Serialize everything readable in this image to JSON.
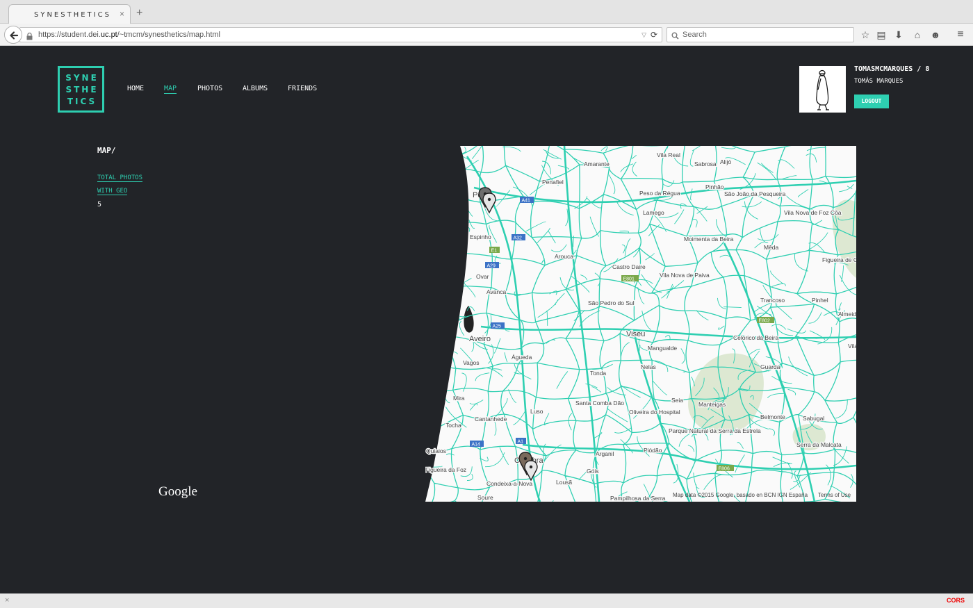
{
  "browser": {
    "tab_title": "SYNESTHETICS",
    "tab_close": "×",
    "new_tab": "+",
    "url_prefix": "https://student.dei.",
    "url_host": "uc.pt",
    "url_path": "/~tmcm/synesthetics/map.html",
    "search_placeholder": "Search",
    "status_label": "CORS",
    "status_close": "×"
  },
  "site": {
    "logo_lines": [
      "SYNE",
      "STHE",
      "TICS"
    ],
    "nav": [
      {
        "label": "HOME",
        "active": false
      },
      {
        "label": "MAP",
        "active": true
      },
      {
        "label": "PHOTOS",
        "active": false
      },
      {
        "label": "ALBUMS",
        "active": false
      },
      {
        "label": "FRIENDS",
        "active": false
      }
    ],
    "accent_color": "#2ecfb1",
    "background_color": "#222428"
  },
  "profile": {
    "username_line": "TOMASMCMARQUES / 8",
    "real_name": "TOMÁS MARQUES",
    "logout_label": "LOGOUT"
  },
  "main": {
    "section_title": "MAP/",
    "stats_label_1": "TOTAL PHOTOS",
    "stats_label_2": "WITH GEO",
    "stats_value": "5",
    "google_logo": "Google"
  },
  "map": {
    "attribution": "Map data ©2015 Google, basado en BCN IGN España",
    "terms": "Terms of Use",
    "road_color": "#2ecfb1",
    "places": [
      "Vila Real",
      "Amarante",
      "Sabrosa",
      "Alijó",
      "Penafiel",
      "Peso da Régua",
      "Pinhão",
      "São João da Pesqueira",
      "Porto",
      "Lamego",
      "Vila Nova de Foz Côa",
      "Espinho",
      "Moimenta da Beira",
      "Mêda",
      "Arouca",
      "Castro Daire",
      "Figueira de Castelo Rodrigo",
      "Ovar",
      "Avanca",
      "Vila Nova de Paiva",
      "São Pedro do Sul",
      "Trancoso",
      "Pinhel",
      "Almeida",
      "Viseu",
      "Aveiro",
      "Mangualde",
      "Celorico da Beira",
      "Vilar",
      "Águeda",
      "Vagos",
      "Nelas",
      "Guarda",
      "Tonda",
      "Mira",
      "Santa Comba Dão",
      "Oliveira do Hospital",
      "Seia",
      "Manteigas",
      "Belmonte",
      "Sabugal",
      "Cantanhede",
      "Luso",
      "Tocha",
      "Parque Natural da Serra da Estrela",
      "Serra da Malcata",
      "Quiaios",
      "Coimbra",
      "Arganil",
      "Piódão",
      "Figueira da Foz",
      "Góis",
      "Condeixa-a-Nova",
      "Lousã",
      "Soure",
      "Pampilhosa da Serra"
    ],
    "roads": [
      "A41",
      "A32",
      "E1",
      "A29",
      "E801",
      "E802",
      "A25",
      "A14",
      "E806",
      "A1"
    ],
    "markers": [
      {
        "name": "Porto",
        "count": 2
      },
      {
        "name": "Coimbra",
        "count": 3
      }
    ]
  }
}
